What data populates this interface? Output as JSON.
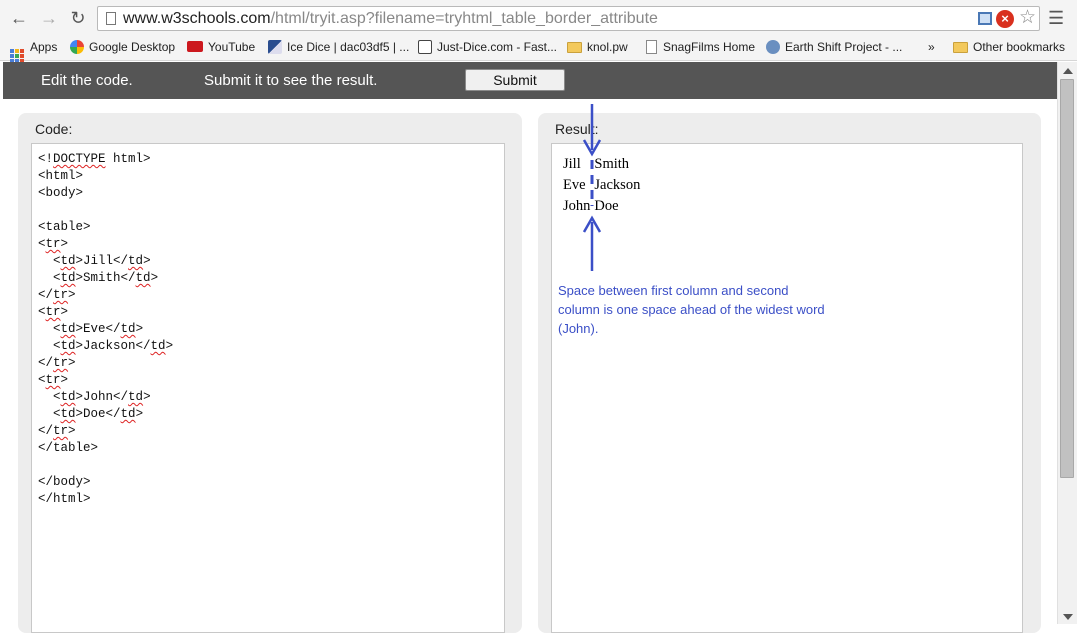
{
  "browser": {
    "url_domain": "www.w3schools.com",
    "url_path": "/html/tryit.asp?filename=tryhtml_table_border_attribute",
    "bookmarks": [
      {
        "label": "Apps",
        "icon": "apps-icon"
      },
      {
        "label": "Google Desktop",
        "icon": "google-desktop-icon"
      },
      {
        "label": "YouTube",
        "icon": "youtube-icon"
      },
      {
        "label": "Ice Dice | dac03df5 | ...",
        "icon": "ice-dice-icon"
      },
      {
        "label": "Just-Dice.com - Fast...",
        "icon": "just-dice-icon"
      },
      {
        "label": "knol.pw",
        "icon": "folder-icon"
      },
      {
        "label": "SnagFilms Home",
        "icon": "page-icon"
      },
      {
        "label": "Earth Shift Project - ...",
        "icon": "earth-shift-icon"
      }
    ],
    "overflow": "»",
    "other_bookmarks": "Other bookmarks"
  },
  "toolbar": {
    "edit_text": "Edit the code.",
    "submit_text": "Submit it to see the result.",
    "submit_button": "Submit"
  },
  "code_panel": {
    "label": "Code:"
  },
  "result_panel": {
    "label": "Result:",
    "table": [
      [
        "Jill",
        "Smith"
      ],
      [
        "Eve",
        "Jackson"
      ],
      [
        "John",
        "Doe"
      ]
    ],
    "annotation": "Space between first column and second column is one space ahead of the widest word (John)."
  },
  "colors": {
    "toolbar_bg": "#555555",
    "annotation": "#3b4fc7",
    "spellcheck": "#dd2222"
  }
}
